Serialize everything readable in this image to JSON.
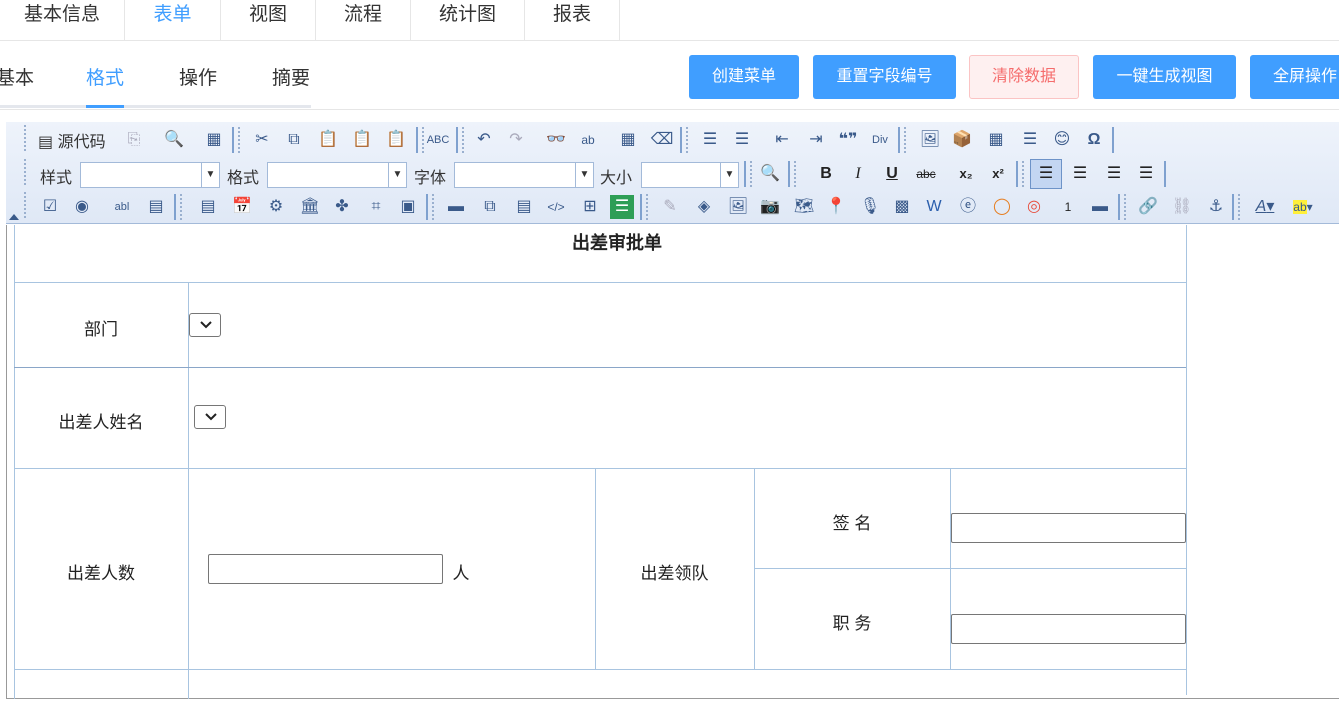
{
  "top_tabs": [
    {
      "label": "基本信息"
    },
    {
      "label": "表单",
      "active": true
    },
    {
      "label": "视图"
    },
    {
      "label": "流程"
    },
    {
      "label": "统计图"
    },
    {
      "label": "报表"
    }
  ],
  "sub_tabs": [
    {
      "label": "基本"
    },
    {
      "label": "格式",
      "active": true
    },
    {
      "label": "操作"
    },
    {
      "label": "摘要"
    }
  ],
  "actions": {
    "create_menu": "创建菜单",
    "reset_field_numbers": "重置字段编号",
    "clear_data": "清除数据",
    "generate_view": "一键生成视图",
    "fullscreen": "全屏操作"
  },
  "toolbar": {
    "source_label": "源代码",
    "style_label": "样式",
    "format_label": "格式",
    "font_label": "字体",
    "size_label": "大小",
    "bold": "B",
    "italic": "I",
    "underline": "U",
    "strike": "abc",
    "omega": "Ω",
    "quote": "❝❞",
    "font_color": "A",
    "bg_color": "ab"
  },
  "colors": {
    "primary": "#409eff",
    "danger": "#f56c6c",
    "toolbar_bg": "#dfe8f6",
    "grid_line": "#a8c4e0"
  },
  "form": {
    "title": "出差审批单",
    "department_label": "部门",
    "traveler_name_label": "出差人姓名",
    "traveler_count_label": "出差人数",
    "count_unit": "人",
    "leader_label": "出差领队",
    "signature_label": "签 名",
    "position_label": "职 务",
    "traveler_count_value": "",
    "signature_value": "",
    "position_value": ""
  }
}
